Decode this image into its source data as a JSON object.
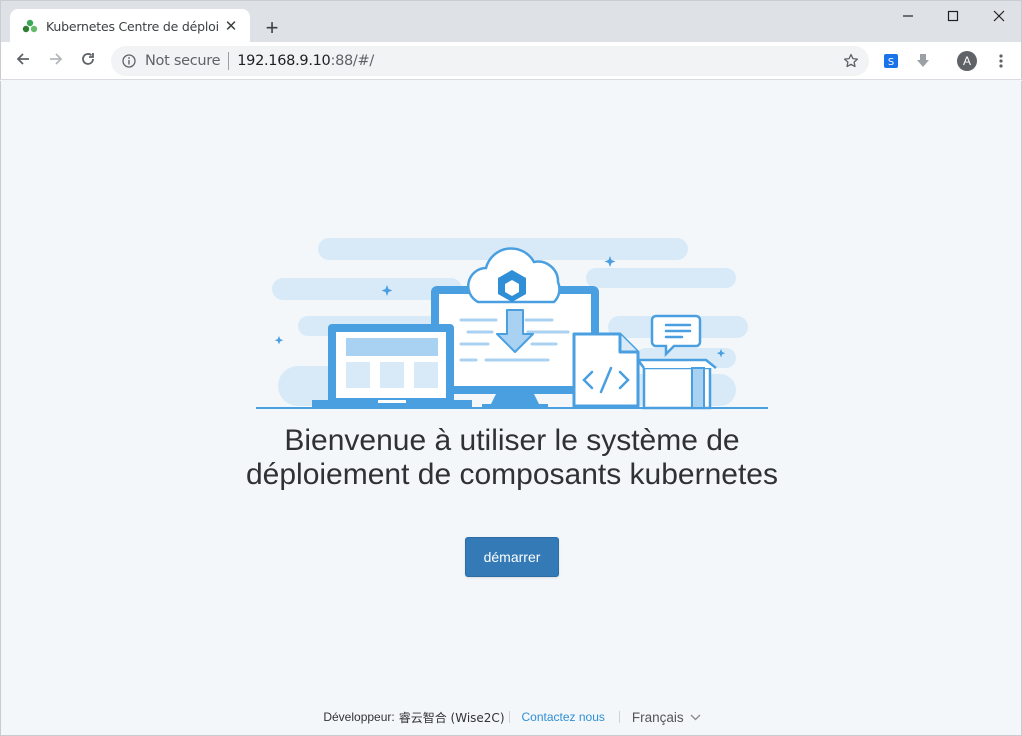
{
  "browser": {
    "tab_title": "Kubernetes Centre de déploiement",
    "tab_close_glyph": "✕",
    "new_tab_glyph": "+",
    "omnibox": {
      "security_label": "Not secure",
      "url_host": "192.168.9.10",
      "url_rest": ":88/#/"
    },
    "profile_initial": "A"
  },
  "page": {
    "headline": "Bienvenue à utiliser le système de déploiement de composants kubernetes",
    "start_button": "démarrer",
    "footer": {
      "developer_label": "Développeur:",
      "developer_name": "睿云智合 (Wise2C)",
      "contact_link": "Contactez nous",
      "language": "Français"
    }
  },
  "colors": {
    "accent": "#337ab7",
    "link": "#2f8fd6",
    "page_bg": "#f3f7fa",
    "illustration_blue": "#4a9fe0",
    "illustration_light": "#d8eaf8"
  },
  "icons": {
    "favicon": "kubernetes-favicon",
    "back": "arrow-left-icon",
    "forward": "arrow-right-icon",
    "reload": "reload-icon",
    "info": "info-circle-icon",
    "bookmark": "star-icon",
    "ext1": "translate-extension-icon",
    "ext2": "download-extension-icon",
    "menu": "more-vert-icon",
    "lang_dropdown": "chevron-down-icon"
  }
}
